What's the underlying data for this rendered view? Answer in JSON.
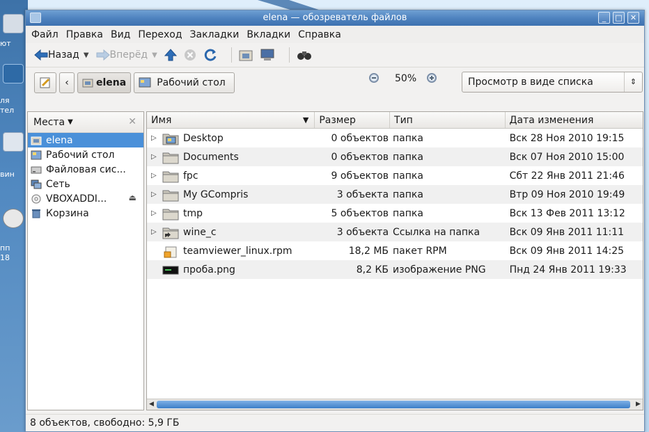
{
  "window": {
    "title": "elena — обозреватель файлов"
  },
  "menubar": {
    "items": [
      "Файл",
      "Правка",
      "Вид",
      "Переход",
      "Закладки",
      "Вкладки",
      "Справка"
    ]
  },
  "toolbar": {
    "back_label": "Назад",
    "forward_label": "Вперёд"
  },
  "location": {
    "crumbs": [
      "elena",
      "Рабочий стол"
    ],
    "zoom_level": "50%",
    "view_mode": "Просмотр в виде списка"
  },
  "sidebar": {
    "header": "Места",
    "items": [
      {
        "label": "elena",
        "icon": "home-folder-icon"
      },
      {
        "label": "Рабочий стол",
        "icon": "desktop-icon"
      },
      {
        "label": "Файловая сис...",
        "icon": "drive-icon"
      },
      {
        "label": "Сеть",
        "icon": "network-icon"
      },
      {
        "label": "VBOXADDI...",
        "icon": "optical-disc-icon"
      },
      {
        "label": "Корзина",
        "icon": "trash-icon"
      }
    ]
  },
  "columns": {
    "name": "Имя",
    "size": "Размер",
    "type": "Тип",
    "date": "Дата изменения"
  },
  "files": [
    {
      "name": "Desktop",
      "size": "0 объектов",
      "type": "папка",
      "date": "Вск 28 Ноя 2010 19:15",
      "icon": "desktop-folder-icon",
      "expandable": true
    },
    {
      "name": "Documents",
      "size": "0 объектов",
      "type": "папка",
      "date": "Вск 07 Ноя 2010 15:00",
      "icon": "folder-icon",
      "expandable": true
    },
    {
      "name": "fpc",
      "size": "9 объектов",
      "type": "папка",
      "date": "Сбт 22 Янв 2011 21:46",
      "icon": "folder-icon",
      "expandable": true
    },
    {
      "name": "My GCompris",
      "size": "3 объекта",
      "type": "папка",
      "date": "Втр 09 Ноя 2010 19:49",
      "icon": "folder-icon",
      "expandable": true
    },
    {
      "name": "tmp",
      "size": "5 объектов",
      "type": "папка",
      "date": "Вск 13 Фев 2011 13:12",
      "icon": "folder-icon",
      "expandable": true
    },
    {
      "name": "wine_c",
      "size": "3 объекта",
      "type": "Ссылка на папка",
      "date": "Вск 09 Янв 2011 11:11",
      "icon": "folder-link-icon",
      "expandable": true
    },
    {
      "name": "teamviewer_linux.rpm",
      "size": "18,2 МБ",
      "type": "пакет RPM",
      "date": "Вск 09 Янв 2011 14:25",
      "icon": "package-icon",
      "expandable": false
    },
    {
      "name": "проба.png",
      "size": "8,2 КБ",
      "type": "изображение PNG",
      "date": "Пнд 24 Янв 2011 19:33",
      "icon": "image-file-icon",
      "expandable": false
    }
  ],
  "status": {
    "text": "8 объектов, свободно: 5,9 ГБ"
  },
  "desktop": {
    "labels": [
      "ют",
      "ля",
      "тел",
      "вин",
      "пп",
      "18"
    ]
  }
}
